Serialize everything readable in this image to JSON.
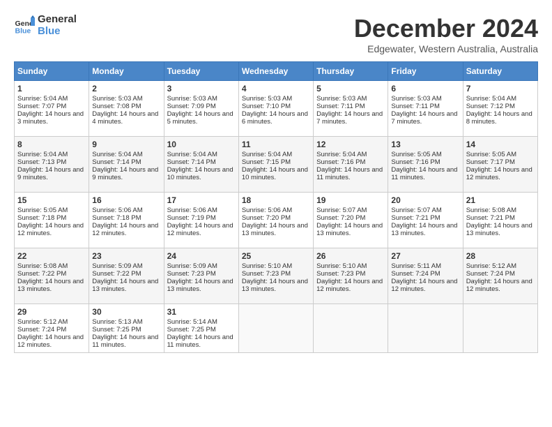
{
  "header": {
    "logo_general": "General",
    "logo_blue": "Blue",
    "title": "December 2024",
    "location": "Edgewater, Western Australia, Australia"
  },
  "calendar": {
    "days_of_week": [
      "Sunday",
      "Monday",
      "Tuesday",
      "Wednesday",
      "Thursday",
      "Friday",
      "Saturday"
    ],
    "weeks": [
      [
        null,
        null,
        {
          "day": 3,
          "sunrise": "5:03 AM",
          "sunset": "7:09 PM",
          "daylight": "14 hours and 5 minutes."
        },
        {
          "day": 4,
          "sunrise": "5:03 AM",
          "sunset": "7:10 PM",
          "daylight": "14 hours and 6 minutes."
        },
        {
          "day": 5,
          "sunrise": "5:03 AM",
          "sunset": "7:11 PM",
          "daylight": "14 hours and 7 minutes."
        },
        {
          "day": 6,
          "sunrise": "5:03 AM",
          "sunset": "7:11 PM",
          "daylight": "14 hours and 7 minutes."
        },
        {
          "day": 7,
          "sunrise": "5:04 AM",
          "sunset": "7:12 PM",
          "daylight": "14 hours and 8 minutes."
        }
      ],
      [
        {
          "day": 1,
          "sunrise": "5:04 AM",
          "sunset": "7:07 PM",
          "daylight": "14 hours and 3 minutes."
        },
        {
          "day": 2,
          "sunrise": "5:03 AM",
          "sunset": "7:08 PM",
          "daylight": "14 hours and 4 minutes."
        },
        {
          "day": 3,
          "sunrise": "5:03 AM",
          "sunset": "7:09 PM",
          "daylight": "14 hours and 5 minutes."
        },
        {
          "day": 4,
          "sunrise": "5:03 AM",
          "sunset": "7:10 PM",
          "daylight": "14 hours and 6 minutes."
        },
        {
          "day": 5,
          "sunrise": "5:03 AM",
          "sunset": "7:11 PM",
          "daylight": "14 hours and 7 minutes."
        },
        {
          "day": 6,
          "sunrise": "5:03 AM",
          "sunset": "7:11 PM",
          "daylight": "14 hours and 7 minutes."
        },
        {
          "day": 7,
          "sunrise": "5:04 AM",
          "sunset": "7:12 PM",
          "daylight": "14 hours and 8 minutes."
        }
      ],
      [
        {
          "day": 8,
          "sunrise": "5:04 AM",
          "sunset": "7:13 PM",
          "daylight": "14 hours and 9 minutes."
        },
        {
          "day": 9,
          "sunrise": "5:04 AM",
          "sunset": "7:14 PM",
          "daylight": "14 hours and 9 minutes."
        },
        {
          "day": 10,
          "sunrise": "5:04 AM",
          "sunset": "7:14 PM",
          "daylight": "14 hours and 10 minutes."
        },
        {
          "day": 11,
          "sunrise": "5:04 AM",
          "sunset": "7:15 PM",
          "daylight": "14 hours and 10 minutes."
        },
        {
          "day": 12,
          "sunrise": "5:04 AM",
          "sunset": "7:16 PM",
          "daylight": "14 hours and 11 minutes."
        },
        {
          "day": 13,
          "sunrise": "5:05 AM",
          "sunset": "7:16 PM",
          "daylight": "14 hours and 11 minutes."
        },
        {
          "day": 14,
          "sunrise": "5:05 AM",
          "sunset": "7:17 PM",
          "daylight": "14 hours and 12 minutes."
        }
      ],
      [
        {
          "day": 15,
          "sunrise": "5:05 AM",
          "sunset": "7:18 PM",
          "daylight": "14 hours and 12 minutes."
        },
        {
          "day": 16,
          "sunrise": "5:06 AM",
          "sunset": "7:18 PM",
          "daylight": "14 hours and 12 minutes."
        },
        {
          "day": 17,
          "sunrise": "5:06 AM",
          "sunset": "7:19 PM",
          "daylight": "14 hours and 12 minutes."
        },
        {
          "day": 18,
          "sunrise": "5:06 AM",
          "sunset": "7:20 PM",
          "daylight": "14 hours and 13 minutes."
        },
        {
          "day": 19,
          "sunrise": "5:07 AM",
          "sunset": "7:20 PM",
          "daylight": "14 hours and 13 minutes."
        },
        {
          "day": 20,
          "sunrise": "5:07 AM",
          "sunset": "7:21 PM",
          "daylight": "14 hours and 13 minutes."
        },
        {
          "day": 21,
          "sunrise": "5:08 AM",
          "sunset": "7:21 PM",
          "daylight": "14 hours and 13 minutes."
        }
      ],
      [
        {
          "day": 22,
          "sunrise": "5:08 AM",
          "sunset": "7:22 PM",
          "daylight": "14 hours and 13 minutes."
        },
        {
          "day": 23,
          "sunrise": "5:09 AM",
          "sunset": "7:22 PM",
          "daylight": "14 hours and 13 minutes."
        },
        {
          "day": 24,
          "sunrise": "5:09 AM",
          "sunset": "7:23 PM",
          "daylight": "14 hours and 13 minutes."
        },
        {
          "day": 25,
          "sunrise": "5:10 AM",
          "sunset": "7:23 PM",
          "daylight": "14 hours and 13 minutes."
        },
        {
          "day": 26,
          "sunrise": "5:10 AM",
          "sunset": "7:23 PM",
          "daylight": "14 hours and 12 minutes."
        },
        {
          "day": 27,
          "sunrise": "5:11 AM",
          "sunset": "7:24 PM",
          "daylight": "14 hours and 12 minutes."
        },
        {
          "day": 28,
          "sunrise": "5:12 AM",
          "sunset": "7:24 PM",
          "daylight": "14 hours and 12 minutes."
        }
      ],
      [
        {
          "day": 29,
          "sunrise": "5:12 AM",
          "sunset": "7:24 PM",
          "daylight": "14 hours and 12 minutes."
        },
        {
          "day": 30,
          "sunrise": "5:13 AM",
          "sunset": "7:25 PM",
          "daylight": "14 hours and 11 minutes."
        },
        {
          "day": 31,
          "sunrise": "5:14 AM",
          "sunset": "7:25 PM",
          "daylight": "14 hours and 11 minutes."
        },
        null,
        null,
        null,
        null
      ]
    ],
    "actual_week1": [
      {
        "day": 1,
        "sunrise": "5:04 AM",
        "sunset": "7:07 PM",
        "daylight": "14 hours and 3 minutes."
      },
      {
        "day": 2,
        "sunrise": "5:03 AM",
        "sunset": "7:08 PM",
        "daylight": "14 hours and 4 minutes."
      },
      {
        "day": 3,
        "sunrise": "5:03 AM",
        "sunset": "7:09 PM",
        "daylight": "14 hours and 5 minutes."
      },
      {
        "day": 4,
        "sunrise": "5:03 AM",
        "sunset": "7:10 PM",
        "daylight": "14 hours and 6 minutes."
      },
      {
        "day": 5,
        "sunrise": "5:03 AM",
        "sunset": "7:11 PM",
        "daylight": "14 hours and 7 minutes."
      },
      {
        "day": 6,
        "sunrise": "5:03 AM",
        "sunset": "7:11 PM",
        "daylight": "14 hours and 7 minutes."
      },
      {
        "day": 7,
        "sunrise": "5:04 AM",
        "sunset": "7:12 PM",
        "daylight": "14 hours and 8 minutes."
      }
    ]
  }
}
